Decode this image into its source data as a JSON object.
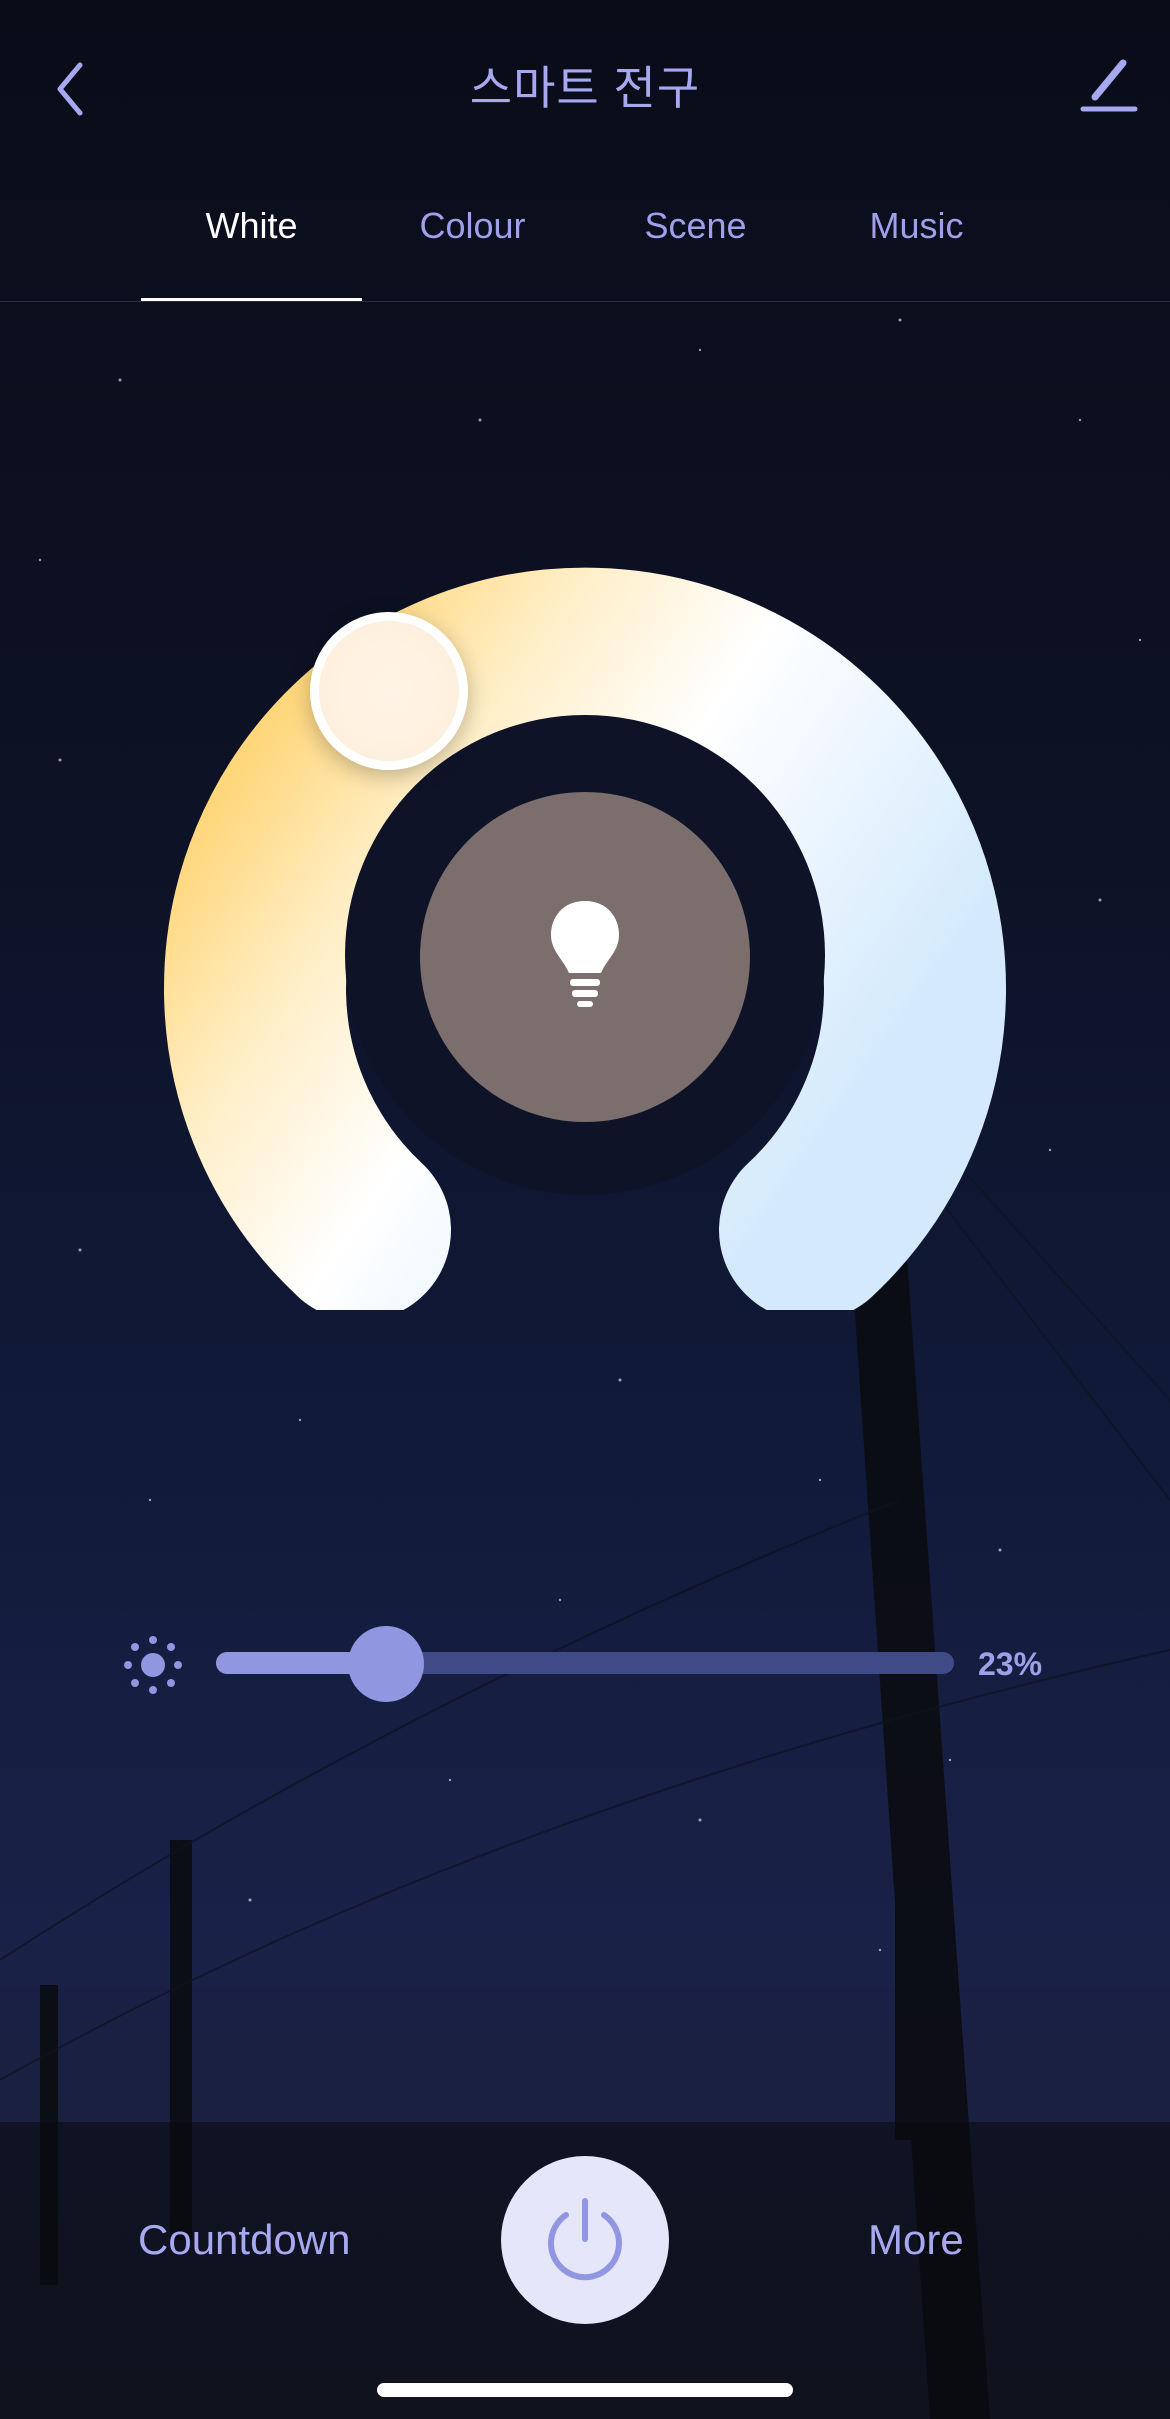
{
  "header": {
    "title": "스마트 전구",
    "back_icon": "chevron-left-icon",
    "edit_icon": "pencil-icon"
  },
  "tabs": [
    {
      "label": "White",
      "active": true
    },
    {
      "label": "Colour",
      "active": false
    },
    {
      "label": "Scene",
      "active": false
    },
    {
      "label": "Music",
      "active": false
    }
  ],
  "light_control": {
    "center_icon": "lightbulb-icon",
    "warm_color": "#ffd066",
    "cool_color": "#d8ecff"
  },
  "brightness": {
    "icon": "sun-icon",
    "value": 23,
    "value_label": "23%"
  },
  "bottom_bar": {
    "countdown_label": "Countdown",
    "more_label": "More",
    "power_icon": "power-icon"
  },
  "colors": {
    "accent": "#9ea1ea",
    "active_tab": "#ffffff"
  }
}
